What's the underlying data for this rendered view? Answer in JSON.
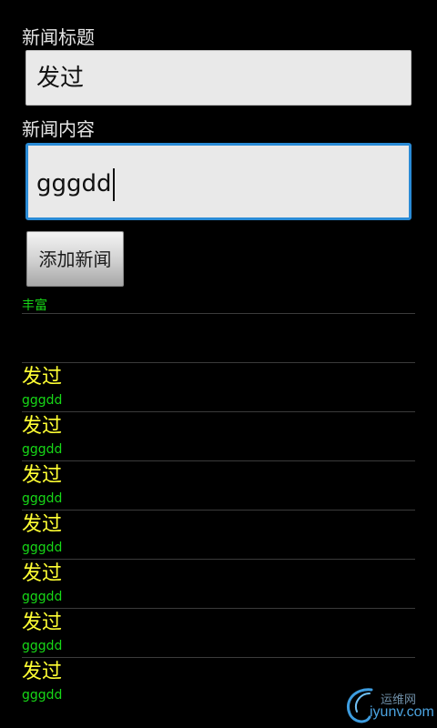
{
  "form": {
    "title_label": "新闻标题",
    "title_value": "发过",
    "content_label": "新闻内容",
    "content_value": "gggdd",
    "add_button_label": "添加新闻"
  },
  "tag_text": "丰富",
  "news": [
    {
      "title": "发过",
      "content": "gggdd"
    },
    {
      "title": "发过",
      "content": "gggdd"
    },
    {
      "title": "发过",
      "content": "gggdd"
    },
    {
      "title": "发过",
      "content": "gggdd"
    },
    {
      "title": "发过",
      "content": "gggdd"
    },
    {
      "title": "发过",
      "content": "gggdd"
    },
    {
      "title": "发过",
      "content": "gggdd"
    }
  ],
  "watermark": {
    "cn": "运维网",
    "en": "iyunv.com"
  },
  "colors": {
    "background": "#000000",
    "news_title": "#ffff33",
    "news_content": "#17d817",
    "focus_border": "#2a8bd6"
  }
}
